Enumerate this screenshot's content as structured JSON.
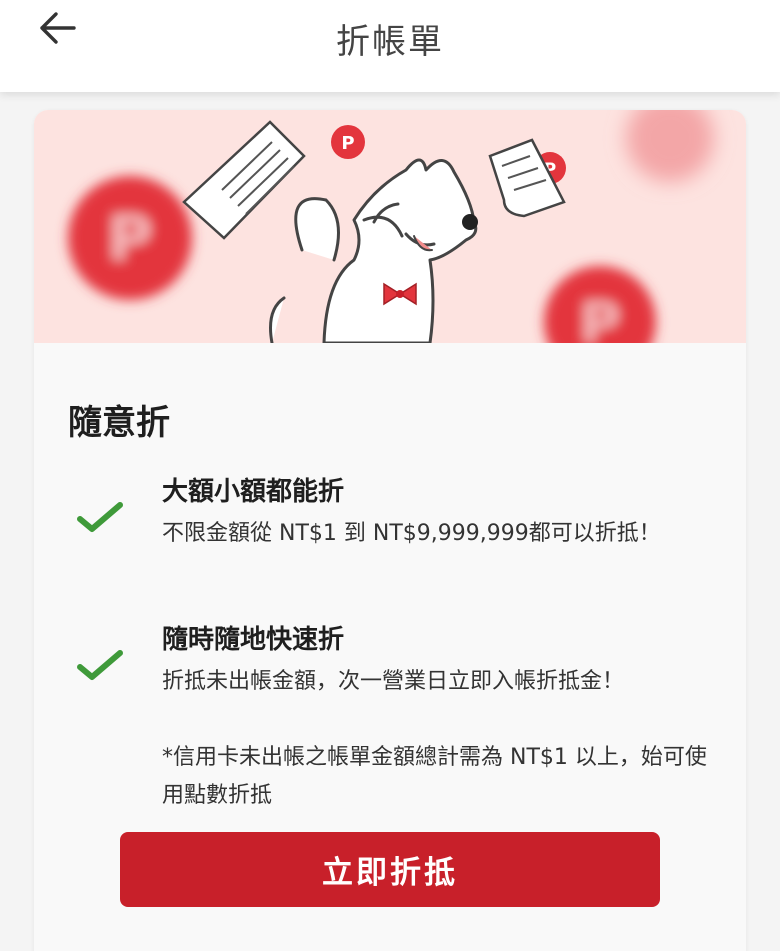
{
  "header": {
    "title": "折帳單",
    "back_icon": "arrow-left-icon"
  },
  "banner": {
    "illustration": "dog-with-flying-receipts-and-coins",
    "colors": {
      "background": "#fde3e0",
      "coin": "#e3353d"
    }
  },
  "section": {
    "title": "隨意折",
    "features": [
      {
        "icon": "check-icon",
        "title": "大額小額都能折",
        "description": "不限金額從 NT$1 到 NT$9,999,999都可以折抵！"
      },
      {
        "icon": "check-icon",
        "title": "隨時隨地快速折",
        "description": "折抵未出帳金額，次一營業日立即入帳折抵金！",
        "note": "*信用卡未出帳之帳單金額總計需為 NT$1 以上，始可使用點數折抵"
      }
    ]
  },
  "cta": {
    "label": "立即折抵",
    "color": "#c8202a"
  },
  "colors": {
    "check": "#3f9a3a",
    "page_bg": "#f4f4f4"
  }
}
